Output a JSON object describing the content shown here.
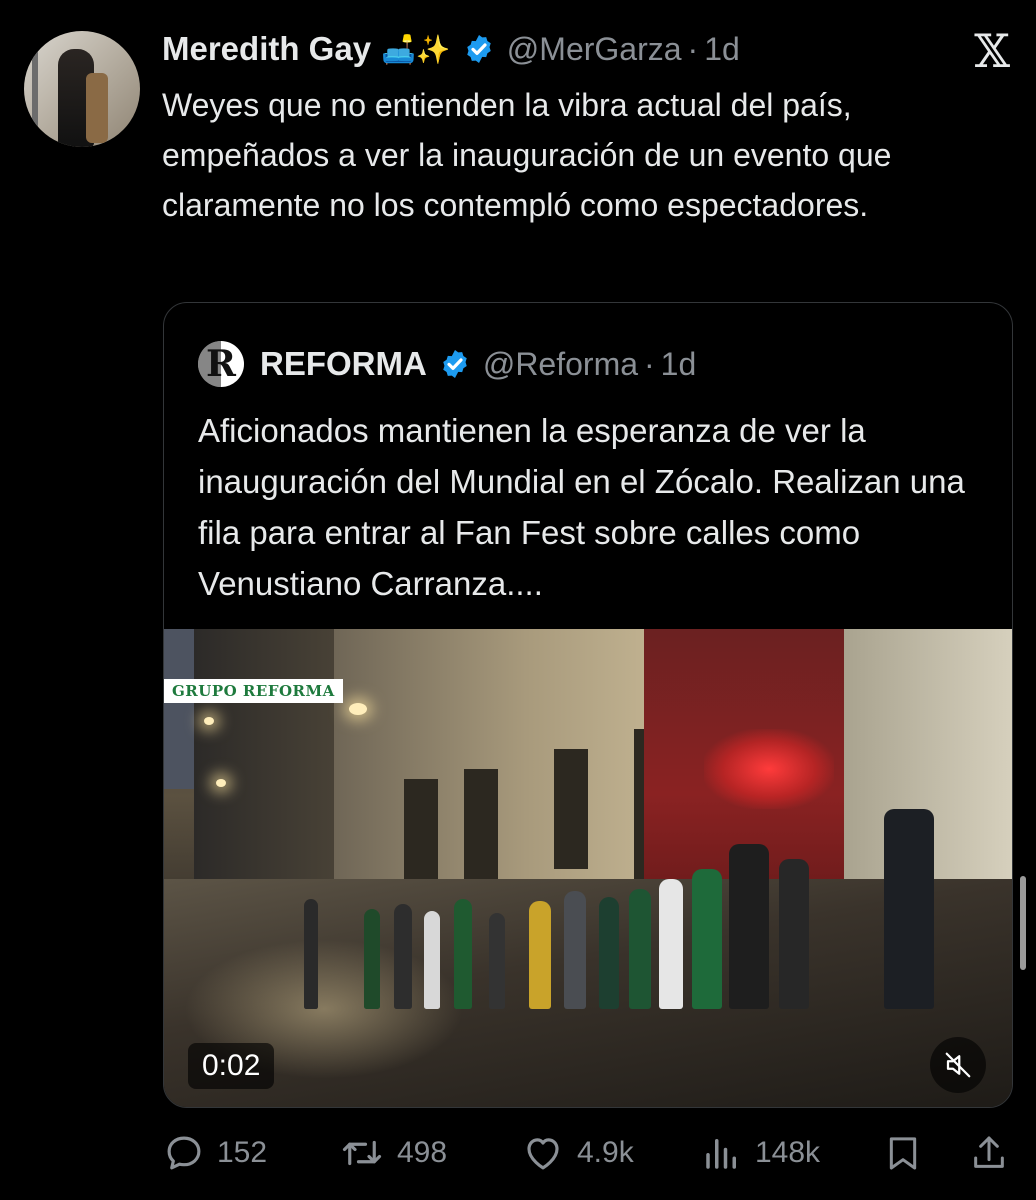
{
  "tweet": {
    "author_name": "Meredith Gay",
    "author_emoji": "🛋️✨",
    "author_handle": "@MerGarza",
    "separator": "·",
    "age": "1d",
    "text": "Weyes que no entienden la vibra actual del país, empeñados a ver la inauguración de un evento que claramente no los contempló como espectadores."
  },
  "quoted": {
    "logo_letter": "R",
    "author_name": "REFORMA",
    "author_handle": "@Reforma",
    "separator": "·",
    "age": "1d",
    "text": "Aficionados mantienen la esperanza de ver la inauguración del Mundial en el Zócalo. Realizan una fila para entrar al Fan Fest sobre calles como Venustiano Carranza....",
    "media": {
      "watermark": "GRUPO REFORMA",
      "duration": "0:02",
      "muted": true
    }
  },
  "actions": {
    "replies": "152",
    "reposts": "498",
    "likes": "4.9k",
    "views": "148k"
  },
  "colors": {
    "background": "#000000",
    "text": "#e7e9ea",
    "muted": "#8b9096",
    "verified": "#1d9bf0",
    "border": "#333639"
  },
  "icons": [
    "x-logo-icon",
    "verified-badge-icon",
    "reply-icon",
    "repost-icon",
    "like-icon",
    "views-icon",
    "bookmark-icon",
    "share-icon",
    "mute-icon"
  ]
}
